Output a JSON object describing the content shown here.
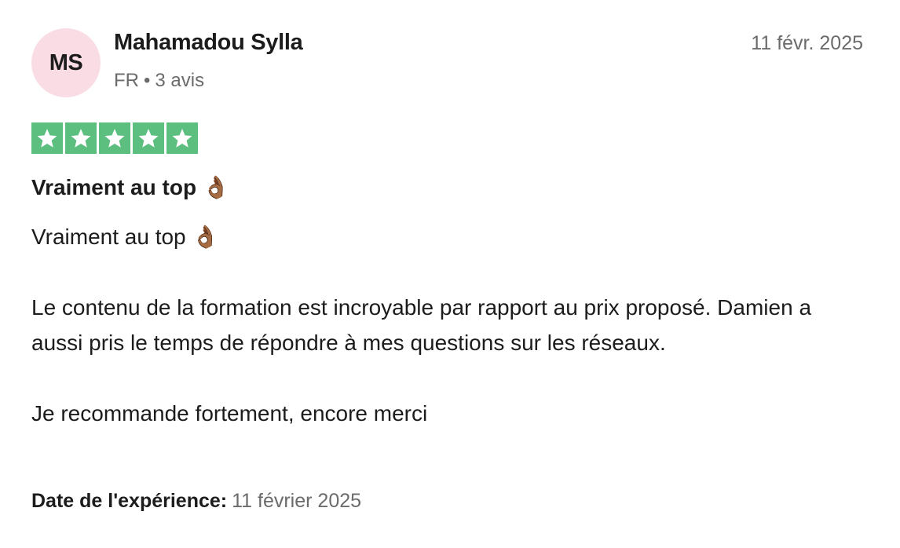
{
  "reviewer": {
    "initials": "MS",
    "name": "Mahamadou Sylla",
    "country": "FR",
    "separator": "•",
    "review_count": "3 avis",
    "avatar_color": "#f9dce4"
  },
  "review": {
    "date": "11 févr. 2025",
    "rating": 5,
    "rating_max": 5,
    "star_color": "#5cbf7f",
    "title": "Vraiment au top 👌🏾",
    "body": {
      "para1": "Vraiment au top 👌🏾",
      "para2": "Le contenu de la formation est incroyable par rapport au prix proposé. Damien a aussi pris le temps de répondre à mes questions sur les réseaux.",
      "para3": "Je recommande fortement, encore merci"
    },
    "experience_label": "Date de l'expérience:",
    "experience_date": "11 février 2025"
  }
}
